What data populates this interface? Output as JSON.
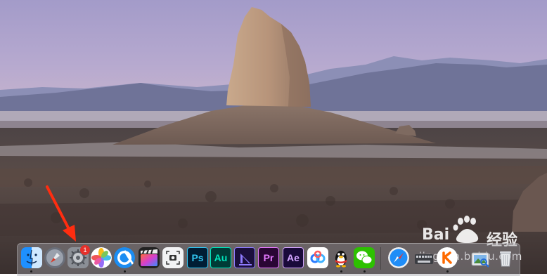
{
  "watermark": {
    "brand_text": "Bai",
    "brand_text_2": "经验",
    "url": "jingyan.baidu.com"
  },
  "dock": {
    "apps": [
      {
        "name": "Finder",
        "icon": "finder-icon",
        "running": true
      },
      {
        "name": "Launchpad",
        "icon": "launchpad-icon",
        "running": false
      },
      {
        "name": "System Preferences",
        "icon": "gear-icon",
        "running": false,
        "badge": "1"
      },
      {
        "name": "Photos",
        "icon": "photos-icon",
        "running": false
      },
      {
        "name": "Browser",
        "icon": "browser-icon",
        "running": true
      },
      {
        "name": "Final Cut Pro",
        "icon": "clapper-icon",
        "running": false
      },
      {
        "name": "Screenshot",
        "icon": "screenshot-icon",
        "running": false
      },
      {
        "name": "Photoshop",
        "icon": "photoshop-icon",
        "label": "Ps",
        "running": false
      },
      {
        "name": "Audition",
        "icon": "audition-icon",
        "label": "Au",
        "running": false
      },
      {
        "name": "Media Encoder",
        "icon": "media-encoder-icon",
        "running": false
      },
      {
        "name": "Premiere Pro",
        "icon": "premiere-icon",
        "label": "Pr",
        "running": false
      },
      {
        "name": "After Effects",
        "icon": "after-effects-icon",
        "label": "Ae",
        "running": false
      },
      {
        "name": "Baidu Netdisk",
        "icon": "cloud-icon",
        "running": false
      },
      {
        "name": "QQ",
        "icon": "qq-penguin-icon",
        "running": true
      },
      {
        "name": "WeChat",
        "icon": "wechat-icon",
        "running": true
      },
      {
        "name": "Safari",
        "icon": "safari-compass-icon",
        "running": false
      },
      {
        "name": "Keyboard Viewer",
        "icon": "keyboard-icon",
        "running": false
      },
      {
        "name": "Kwai",
        "icon": "kwai-icon",
        "running": true
      },
      {
        "name": "Preview",
        "icon": "preview-icon",
        "running": false
      },
      {
        "name": "Trash",
        "icon": "trash-icon",
        "running": false
      }
    ]
  },
  "colors": {
    "photoshop_bg": "#001d34",
    "photoshop_fg": "#31c5f0",
    "audition_bg": "#003b36",
    "audition_fg": "#00e4bb",
    "premiere_bg": "#2a0634",
    "premiere_fg": "#e579ff",
    "after_effects_bg": "#1a0a3a",
    "after_effects_fg": "#d3a4ff",
    "media_encoder_bg": "#1b0f3c",
    "badge": "#e5312b",
    "arrow": "#ff2d10"
  }
}
